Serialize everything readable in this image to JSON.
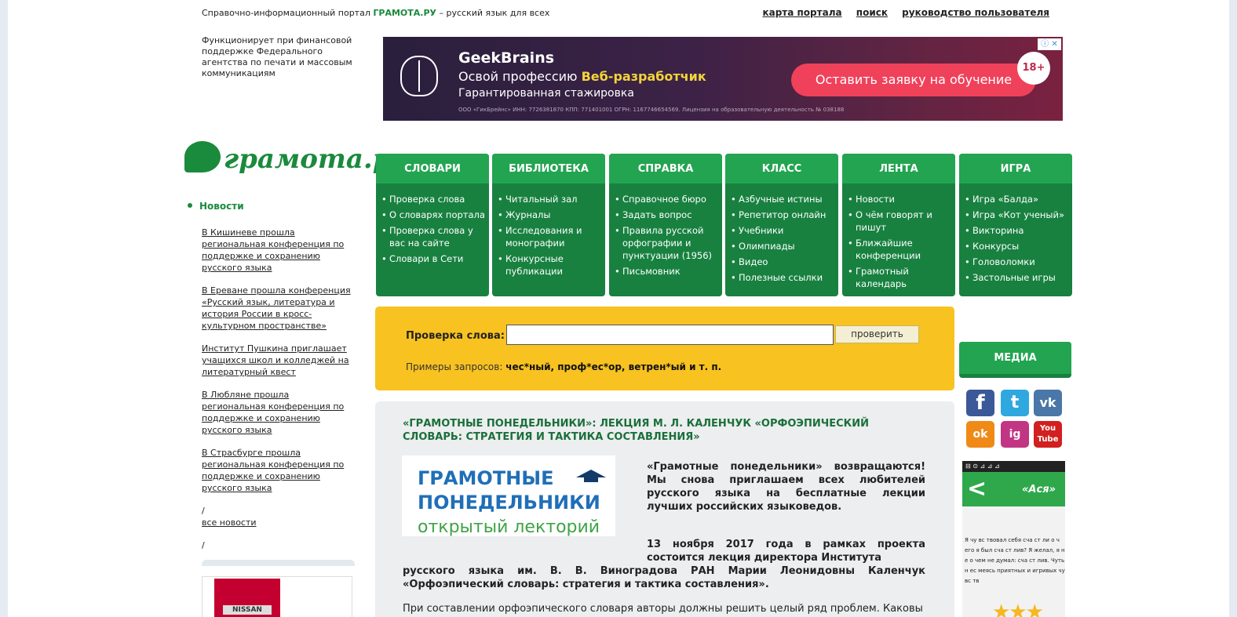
{
  "header": {
    "tagline_prefix": "Справочно-информационный портал",
    "tagline_brand": "ГРАМОТА.РУ",
    "tagline_suffix": "– русский язык для всех",
    "links": [
      "карта портала",
      "поиск",
      "руководство пользователя"
    ]
  },
  "funding": "Функционирует при финансовой поддержке Федерального агентства по печати и массовым коммуникациям",
  "ad": {
    "brand": "GeekBrains",
    "line1_prefix": "Освой профессию",
    "line1_highlight": "Веб-разработчик",
    "line2": "Гарантированная стажировка",
    "legal": "ООО «ГикБрейнс» ИНН: 7726381870 КПП: 771401001 ОГРН: 1167746654569. Лицензия на образовательную деятельность № 038188",
    "cta": "Оставить заявку на обучение",
    "age": "18+",
    "adchoice": "ⓘ ✕"
  },
  "logo": "грамота.ру",
  "news": {
    "heading": "Новости",
    "items": [
      "В Кишиневе прошла региональная конференция по поддержке и сохранению русского языка",
      "В Ереване прошла конференция «Русский язык, литература и история России в кросс-культурном пространстве»",
      "Институт Пушкина приглашает учащихся школ и колледжей на литературный квест",
      "В Любляне прошла региональная конференция по поддержке и сохранению русского языка",
      "В Страсбурге прошла региональная конференция по поддержке и сохранению русского языка"
    ],
    "all_prefix": "/",
    "all": "все новости",
    "all_suffix": "/"
  },
  "nissan": "NISSAN",
  "menus": [
    {
      "title": "СЛОВАРИ",
      "items": [
        "Проверка слова",
        "О словарях портала",
        "Проверка слова у вас на сайте",
        "Словари в Сети"
      ]
    },
    {
      "title": "БИБЛИОТЕКА",
      "items": [
        "Читальный зал",
        "Журналы",
        "Исследования и монографии",
        "Конкурсные публикации"
      ]
    },
    {
      "title": "СПРАВКА",
      "items": [
        "Справочное бюро",
        "Задать вопрос",
        "Правила русской орфографии и пунктуации (1956)",
        "Письмовник"
      ]
    },
    {
      "title": "КЛАСС",
      "items": [
        "Азбучные истины",
        "Репетитор онлайн",
        "Учебники",
        "Олимпиады",
        "Видео",
        "Полезные ссылки"
      ]
    },
    {
      "title": "ЛЕНТА",
      "items": [
        "Новости",
        "О чём говорят и пишут",
        "Ближайшие конференции",
        "Грамотный календарь"
      ]
    },
    {
      "title": "ИГРА",
      "items": [
        "Игра «Балда»",
        "Игра «Кот ученый»",
        "Викторина",
        "Конкурсы",
        "Головоломки",
        "Застольные игры"
      ]
    }
  ],
  "check": {
    "label": "Проверка слова:",
    "value": "",
    "button": "проверить",
    "examples_prefix": "Примеры запросов:",
    "examples": "чес*ный, проф*ес*ор, ветрен*ый и т. п."
  },
  "media": {
    "title": "МЕДИА",
    "icons": [
      "f",
      "t",
      "vk",
      "ok",
      "ig",
      "You Tube"
    ]
  },
  "app": {
    "status": "⊟ ⊙ ⊿ ⊿ ⊿",
    "back": "<",
    "title": "«Ася»",
    "text": "Я чу вс твовал себя сча ст ли о ч его я был сча ст лив? Я желал, я н е о чем не думал: сча ст лив. Чуть н ес меясь приятных и игривых чу вс тв",
    "stars": "★★★"
  },
  "article": {
    "title": "«ГРАМОТНЫЕ ПОНЕДЕЛЬНИКИ»: ЛЕКЦИЯ М. Л. КАЛЕНЧУК «ОРФОЭПИЧЕСКИЙ СЛОВАРЬ: СТРАТЕГИЯ И ТАКТИКА СОСТАВЛЕНИЯ»",
    "logo_line1": "ГРАМОТНЫЕ",
    "logo_line2": "ПОНЕДЕЛЬНИКИ",
    "logo_line3": "открытый лекторий",
    "intro": "«Грамотные понедельники» возвращаются! Мы снова приглашаем всех любителей русского языка на бесплатные лекции лучших российских языковедов.",
    "para2_part1": "13 ноября 2017 года в рамках проекта состоится лекция директора Института",
    "para2_part2": "русского языка им. В. В. Виноградова РАН Марии Леонидовны Каленчук «Орфоэпический словарь: стратегия и тактика составления».",
    "para3": "При составлении орфоэпического словаря авторы должны решить целый ряд проблем. Каковы"
  }
}
